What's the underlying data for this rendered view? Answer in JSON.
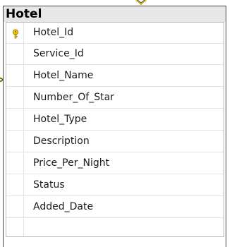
{
  "table": {
    "title": "Hotel",
    "columns": [
      {
        "name": "Hotel_Id",
        "primary_key": true,
        "icon": "key-icon"
      },
      {
        "name": "Service_Id",
        "primary_key": false
      },
      {
        "name": "Hotel_Name",
        "primary_key": false
      },
      {
        "name": "Number_Of_Star",
        "primary_key": false
      },
      {
        "name": "Hotel_Type",
        "primary_key": false
      },
      {
        "name": "Description",
        "primary_key": false
      },
      {
        "name": "Price_Per_Night",
        "primary_key": false
      },
      {
        "name": "Status",
        "primary_key": false
      },
      {
        "name": "Added_Date",
        "primary_key": false
      }
    ]
  },
  "colors": {
    "title_bar": "#e7e7e7",
    "border": "#444444",
    "key_gold": "#f2c400",
    "relation_line": "#c8a800"
  }
}
